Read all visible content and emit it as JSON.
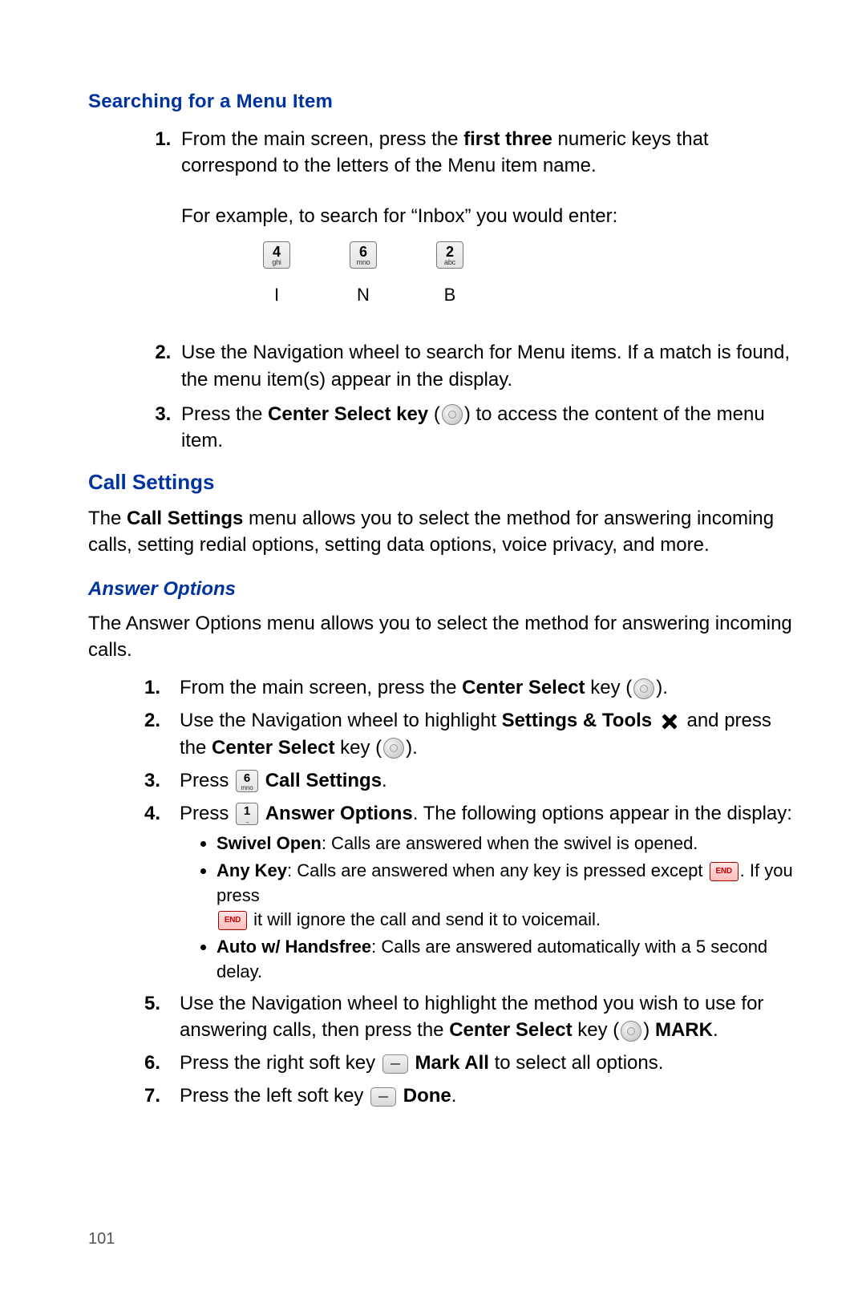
{
  "heading_search": "Searching for a Menu Item",
  "search": {
    "step1_a": "From the main screen, press the ",
    "step1_bold": "first three",
    "step1_b": " numeric keys that correspond to the letters of the Menu item name.",
    "example_intro": "For example, to search for “Inbox” you would enter:",
    "keys": [
      {
        "num": "4",
        "sub": "ghi",
        "letter": "I"
      },
      {
        "num": "6",
        "sub": "mno",
        "letter": "N"
      },
      {
        "num": "2",
        "sub": "abc",
        "letter": "B"
      }
    ],
    "step2": "Use the Navigation wheel to search for Menu items. If a match is found, the menu item(s) appear in the display.",
    "step3_a": "Press the ",
    "step3_bold": "Center Select key",
    "step3_b": " (",
    "step3_c": ") to access the content of the menu item."
  },
  "heading_call": "Call Settings",
  "call_intro_a": "The ",
  "call_intro_bold": "Call Settings",
  "call_intro_b": " menu allows you to select the method for answering incoming calls, setting redial options, setting data options, voice privacy, and more.",
  "heading_answer": "Answer Options",
  "answer_intro": "The Answer Options menu allows you to select the method for answering incoming calls.",
  "ans": {
    "s1_a": "From the main screen, press the ",
    "s1_bold": "Center Select",
    "s1_b": " key (",
    "s1_c": ").",
    "s2_a": "Use the Navigation wheel to highlight ",
    "s2_bold": "Settings & Tools",
    "s2_b": " and press the ",
    "s2_bold2": "Center Select",
    "s2_c": " key (",
    "s2_d": ").",
    "s3_a": "Press ",
    "s3_key_num": "6",
    "s3_key_sub": "mno",
    "s3_bold": "Call Settings",
    "s3_b": ".",
    "s4_a": "Press ",
    "s4_key_num": "1",
    "s4_key_sub": ".,",
    "s4_bold": "Answer Options",
    "s4_b": ". The following options appear in the display:",
    "opt1_bold": "Swivel Open",
    "opt1_rest": ": Calls are answered when the swivel is opened.",
    "opt2_bold": "Any Key",
    "opt2_rest_a": ": Calls are answered when any key is pressed except ",
    "opt2_rest_b": ". If you press ",
    "opt2_rest_c": " it will ignore the call and send it to voicemail.",
    "opt3_bold": "Auto w/ Handsfree",
    "opt3_rest": ": Calls are answered automatically with a 5 second delay.",
    "s5_a": "Use the Navigation wheel to highlight the method you wish to use for answering calls, then press the ",
    "s5_bold": "Center Select",
    "s5_b": " key (",
    "s5_c": ") ",
    "s5_bold2": "MARK",
    "s5_d": ".",
    "s6_a": "Press the right soft key ",
    "s6_bold": "Mark All",
    "s6_b": " to select all options.",
    "s7_a": "Press the left soft key ",
    "s7_bold": "Done",
    "s7_b": "."
  },
  "end_label": "END",
  "page_number": "101"
}
